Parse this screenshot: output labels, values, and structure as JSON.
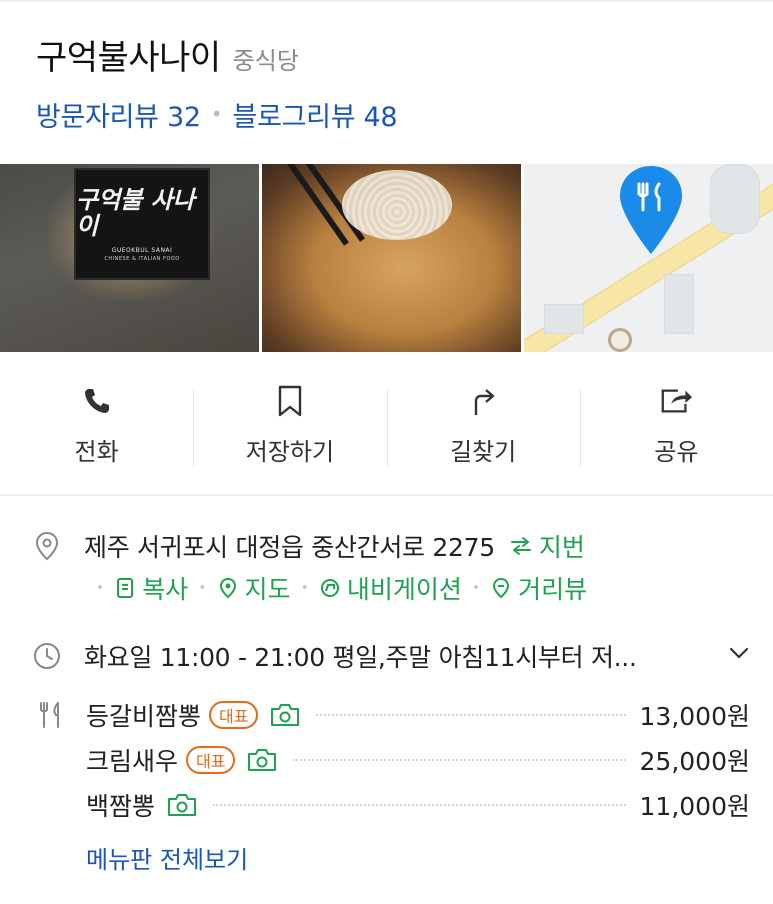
{
  "header": {
    "title": "구억불사나이",
    "category": "중식당",
    "visitor_reviews": "방문자리뷰 32",
    "blog_reviews": "블로그리뷰 48"
  },
  "photos": {
    "sign_text_ko": "구억불 사나이",
    "sign_text_en": "GUEOKBUL SANAI",
    "sign_text_sub": "CHINESE & ITALIAN FOOD"
  },
  "actions": [
    {
      "label": "전화",
      "icon": "phone-icon"
    },
    {
      "label": "저장하기",
      "icon": "bookmark-icon"
    },
    {
      "label": "길찾기",
      "icon": "directions-icon"
    },
    {
      "label": "공유",
      "icon": "share-icon"
    }
  ],
  "address": {
    "text": "제주 서귀포시 대정읍 중산간서로 2275",
    "jibun_label": "지번",
    "links": [
      {
        "label": "복사",
        "icon": "copy-icon"
      },
      {
        "label": "지도",
        "icon": "map-pin-icon"
      },
      {
        "label": "내비게이션",
        "icon": "navigation-icon"
      },
      {
        "label": "거리뷰",
        "icon": "street-view-icon"
      }
    ]
  },
  "hours": {
    "text": "화요일 11:00 - 21:00 평일,주말 아침11시부터 저..."
  },
  "menu": {
    "items": [
      {
        "name": "등갈비짬뽕",
        "badge": "대표",
        "price": "13,000원"
      },
      {
        "name": "크림새우",
        "badge": "대표",
        "price": "25,000원"
      },
      {
        "name": "백짬뽕",
        "badge": "",
        "price": "11,000원"
      }
    ],
    "view_all": "메뉴판 전체보기"
  },
  "colors": {
    "link_blue": "#1a56b8",
    "green": "#1fa352",
    "badge_orange": "#e56a1c",
    "pin_blue": "#1a8be8"
  }
}
